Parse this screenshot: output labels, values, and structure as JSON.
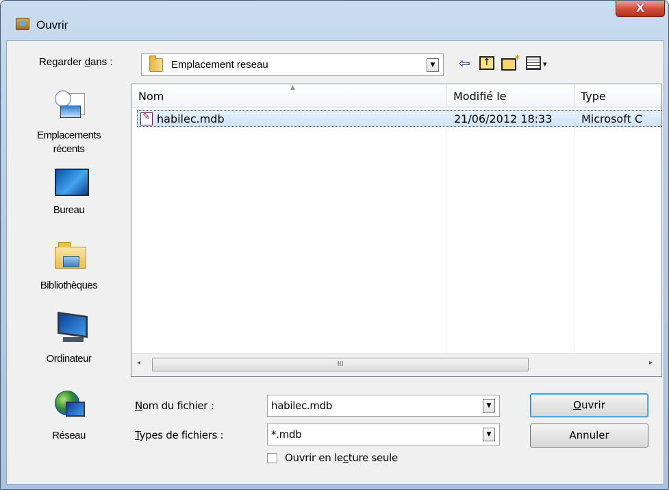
{
  "window": {
    "title": "Ouvrir",
    "close_glyph": "X"
  },
  "lookin": {
    "label_pre": "Regarder ",
    "label_underlined": "d",
    "label_post": "ans :",
    "value": "Emplacement reseau"
  },
  "toolbar": {
    "back_glyph": "⇦",
    "view_arrow": "▾"
  },
  "places": [
    {
      "label_line1": "Emplacements",
      "label_line2": "récents",
      "icon": "recent-places-icon"
    },
    {
      "label_line1": "Bureau",
      "icon": "desktop-icon"
    },
    {
      "label_line1": "Bibliothèques",
      "icon": "libraries-icon"
    },
    {
      "label_line1": "Ordinateur",
      "icon": "computer-icon"
    },
    {
      "label_line1": "Réseau",
      "icon": "network-icon"
    }
  ],
  "filelist": {
    "columns": [
      "Nom",
      "Modifié le",
      "Type"
    ],
    "rows": [
      {
        "name": "habilec.mdb",
        "modified": "21/06/2012 18:33",
        "type": "Microsoft C"
      }
    ],
    "scroll_thumb_grip": "III",
    "scroll_left": "◂",
    "scroll_right": "▸"
  },
  "filename": {
    "label_underlined": "N",
    "label_post": "om du fichier :",
    "value": "habilec.mdb"
  },
  "filetype": {
    "label_underlined": "T",
    "label_post": "ypes de fichiers :",
    "value": "*.mdb"
  },
  "readonly": {
    "label_pre": "Ouvrir en le",
    "label_underlined": "c",
    "label_post": "ture seule",
    "checked": false
  },
  "buttons": {
    "open_underlined": "O",
    "open_post": "uvrir",
    "cancel": "Annuler"
  },
  "dropdown_glyph": "▼"
}
